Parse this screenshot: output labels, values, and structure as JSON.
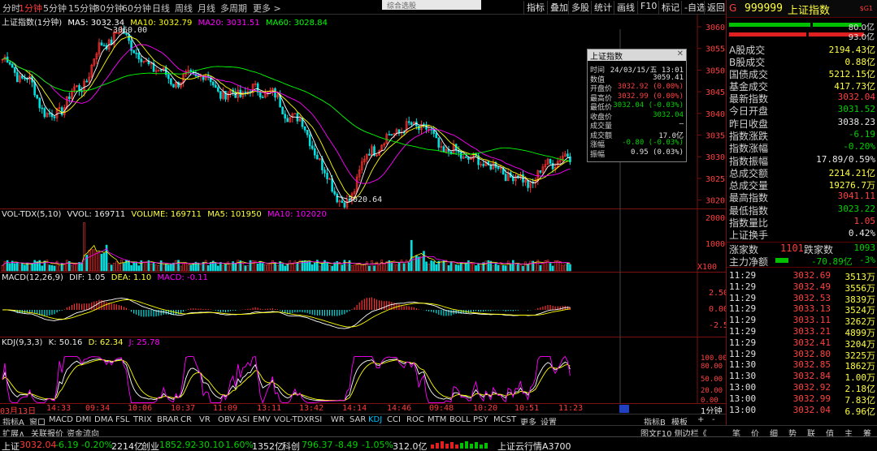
{
  "toolbar": {
    "periods": [
      "分时",
      "1分钟",
      "5分钟",
      "15分钟",
      "30分钟",
      "60分钟",
      "日线",
      "周线",
      "月线",
      "多周期",
      "更多 >"
    ],
    "active_period": "1分钟",
    "search_text": "综合选股",
    "right_buttons": [
      "指标",
      "叠加",
      "多股",
      "统计",
      "画线",
      "F10",
      "标记",
      "-自选",
      "返回"
    ]
  },
  "main_panel": {
    "title": "上证指数(1分钟)",
    "ma": [
      {
        "label": "MA5: 3032.34",
        "color": "#ffffff"
      },
      {
        "label": "MA10: 3032.79",
        "color": "#ffff00"
      },
      {
        "label": "MA20: 3031.51",
        "color": "#ff00ff"
      },
      {
        "label": "MA60: 3028.84",
        "color": "#00ff00"
      }
    ],
    "y_ticks": [
      "3060",
      "3055",
      "3050",
      "3045",
      "3040",
      "3035",
      "3030",
      "3025",
      "3020"
    ],
    "high_label": "3060.00",
    "low_label": "3020.64"
  },
  "popup": {
    "title": "上证指数",
    "rows": [
      {
        "k": "时间",
        "v": "24/03/15/五 13:01",
        "c": "#e0e0e0"
      },
      {
        "k": "数值",
        "v": "3059.41",
        "c": "#e0e0e0"
      },
      {
        "k": "开盘价",
        "v": "3032.92 (0.00%)",
        "c": "#ff4040"
      },
      {
        "k": "最高价",
        "v": "3032.99 (0.00%)",
        "c": "#ff4040"
      },
      {
        "k": "最低价",
        "v": "3032.04 (-0.03%)",
        "c": "#00d000"
      },
      {
        "k": "收盘价",
        "v": "3032.04",
        "c": "#00d000"
      },
      {
        "k": "成交量",
        "v": "—",
        "c": "#e0e0e0"
      },
      {
        "k": "成交额",
        "v": "17.0亿",
        "c": "#e0e0e0"
      },
      {
        "k": "涨幅",
        "v": "-0.80 (-0.03%)",
        "c": "#00d000"
      },
      {
        "k": "振幅",
        "v": "0.95 (0.03%)",
        "c": "#e0e0e0"
      }
    ]
  },
  "vol_panel": {
    "title": "VOL-TDX(5,10)",
    "vvol": "VVOL: 169711",
    "volume": "VOLUME: 169711",
    "ma5": "MA5: 101950",
    "ma10": "MA10: 102020",
    "y_ticks": [
      "20000",
      "10000",
      "X100"
    ]
  },
  "macd_panel": {
    "title": "MACD(12,26,9)",
    "dif": "DIF: 1.05",
    "dea": "DEA: 1.10",
    "macd": "MACD: -0.11",
    "y_ticks": [
      "2.50",
      "0.00",
      "-2.50"
    ]
  },
  "kdj_panel": {
    "title": "KDJ(9,3,3)",
    "k": "K: 50.16",
    "d": "D: 62.34",
    "j": "J: 25.78",
    "y_ticks": [
      "100.00",
      "80.00",
      "50.00",
      "20.00",
      "0.00"
    ]
  },
  "time_axis": [
    "03月13日",
    "14:33",
    "09:34",
    "10:06",
    "10:37",
    "11:09",
    "13:11",
    "13:42",
    "14:14",
    "14:46",
    "09:48",
    "10:20",
    "10:51",
    "11:23"
  ],
  "time_axis_right": "1分钟",
  "indicator_tabs": [
    "指标A",
    "窗口",
    "MACD",
    "DMI",
    "DMA",
    "FSL",
    "TRIX",
    "BRAR",
    "CR",
    "VR",
    "OBV",
    "ASI",
    "EMV",
    "VOL-TDX",
    "RSI",
    "WR",
    "SAR",
    "KDJ",
    "CCI",
    "ROC",
    "MTM",
    "BOLL",
    "PSY",
    "MCST",
    "更多",
    "设置"
  ],
  "active_indicator": "KDJ",
  "indicator_right": [
    "指标B",
    "模板",
    "+",
    "-"
  ],
  "lower_tabs": [
    "扩展∧",
    "关联报价",
    "资金流向"
  ],
  "lower_right": "图文F10 侧边栏《",
  "right_tabs": [
    "笔",
    "价",
    "细",
    "势",
    "联",
    "值",
    "主",
    "筹"
  ],
  "header": {
    "flag": "G",
    "code": "999999",
    "name": "上证指数",
    "badge": "$G1",
    "bar1": "80.0亿",
    "bar2": "93.0亿"
  },
  "info": [
    {
      "k": "A股成交",
      "v": "2194.43亿",
      "c": "#ffff40"
    },
    {
      "k": "B股成交",
      "v": "0.88亿",
      "c": "#ffff40"
    },
    {
      "k": "国债成交",
      "v": "5212.15亿",
      "c": "#ffff40"
    },
    {
      "k": "基金成交",
      "v": "417.73亿",
      "c": "#ffff40"
    },
    {
      "k": "最新指数",
      "v": "3032.04",
      "c": "#ff4040"
    },
    {
      "k": "今日开盘",
      "v": "3031.52",
      "c": "#00d000"
    },
    {
      "k": "昨日收盘",
      "v": "3038.23",
      "c": "#e8e8e8"
    },
    {
      "k": "指数涨跌",
      "v": "-6.19",
      "c": "#00d000"
    },
    {
      "k": "指数涨幅",
      "v": "-0.20%",
      "c": "#00d000"
    },
    {
      "k": "指数振幅",
      "v": "17.89/0.59%",
      "c": "#e8e8e8"
    },
    {
      "k": "总成交额",
      "v": "2214.21亿",
      "c": "#ffff40"
    },
    {
      "k": "总成交量",
      "v": "19276.7万",
      "c": "#ffff40"
    },
    {
      "k": "最高指数",
      "v": "3041.11",
      "c": "#ff4040"
    },
    {
      "k": "最低指数",
      "v": "3023.22",
      "c": "#00d000"
    },
    {
      "k": "指数量比",
      "v": "1.05",
      "c": "#ff4040"
    },
    {
      "k": "上证换手",
      "v": "0.42%",
      "c": "#e8e8e8"
    }
  ],
  "updown": {
    "up_label": "涨家数",
    "up": "1101",
    "down_label": "跌家数",
    "down": "1093"
  },
  "netflow": {
    "label": "主力净额",
    "value": "-70.89亿",
    "pct": "-3%"
  },
  "ticks": [
    {
      "t": "11:29",
      "p": "3032.69",
      "q": "3513万"
    },
    {
      "t": "11:29",
      "p": "3032.49",
      "q": "3556万"
    },
    {
      "t": "11:29",
      "p": "3032.53",
      "q": "3839万"
    },
    {
      "t": "11:29",
      "p": "3033.13",
      "q": "3524万"
    },
    {
      "t": "11:29",
      "p": "3033.11",
      "q": "3262万"
    },
    {
      "t": "11:29",
      "p": "3033.21",
      "q": "4899万"
    },
    {
      "t": "11:29",
      "p": "3032.41",
      "q": "3204万"
    },
    {
      "t": "11:29",
      "p": "3032.80",
      "q": "3225万"
    },
    {
      "t": "11:30",
      "p": "3032.85",
      "q": "1862万"
    },
    {
      "t": "11:30",
      "p": "3032.84",
      "q": "1.00万"
    },
    {
      "t": "13:00",
      "p": "3032.92",
      "q": "2.18亿"
    },
    {
      "t": "13:00",
      "p": "3032.99",
      "q": "7.83亿"
    },
    {
      "t": "13:00",
      "p": "3032.04",
      "q": "6.96亿"
    }
  ],
  "status": {
    "sh_label": "上证",
    "sh_value": "3032.04",
    "sh_change": "-6.19",
    "sh_pct": "-0.20%",
    "sh_amount": "2214亿",
    "cy_label": "创业",
    "cy_value": "1852.92",
    "cy_change": "-30.10",
    "cy_pct": "-1.60%",
    "cy_amount": "1352亿",
    "kc_label": "科创",
    "kc_value": "796.37",
    "kc_change": "-8.49",
    "kc_pct": "-1.05%",
    "kc_amount": "312.0亿",
    "cloud": "上证云行情A3700"
  }
}
